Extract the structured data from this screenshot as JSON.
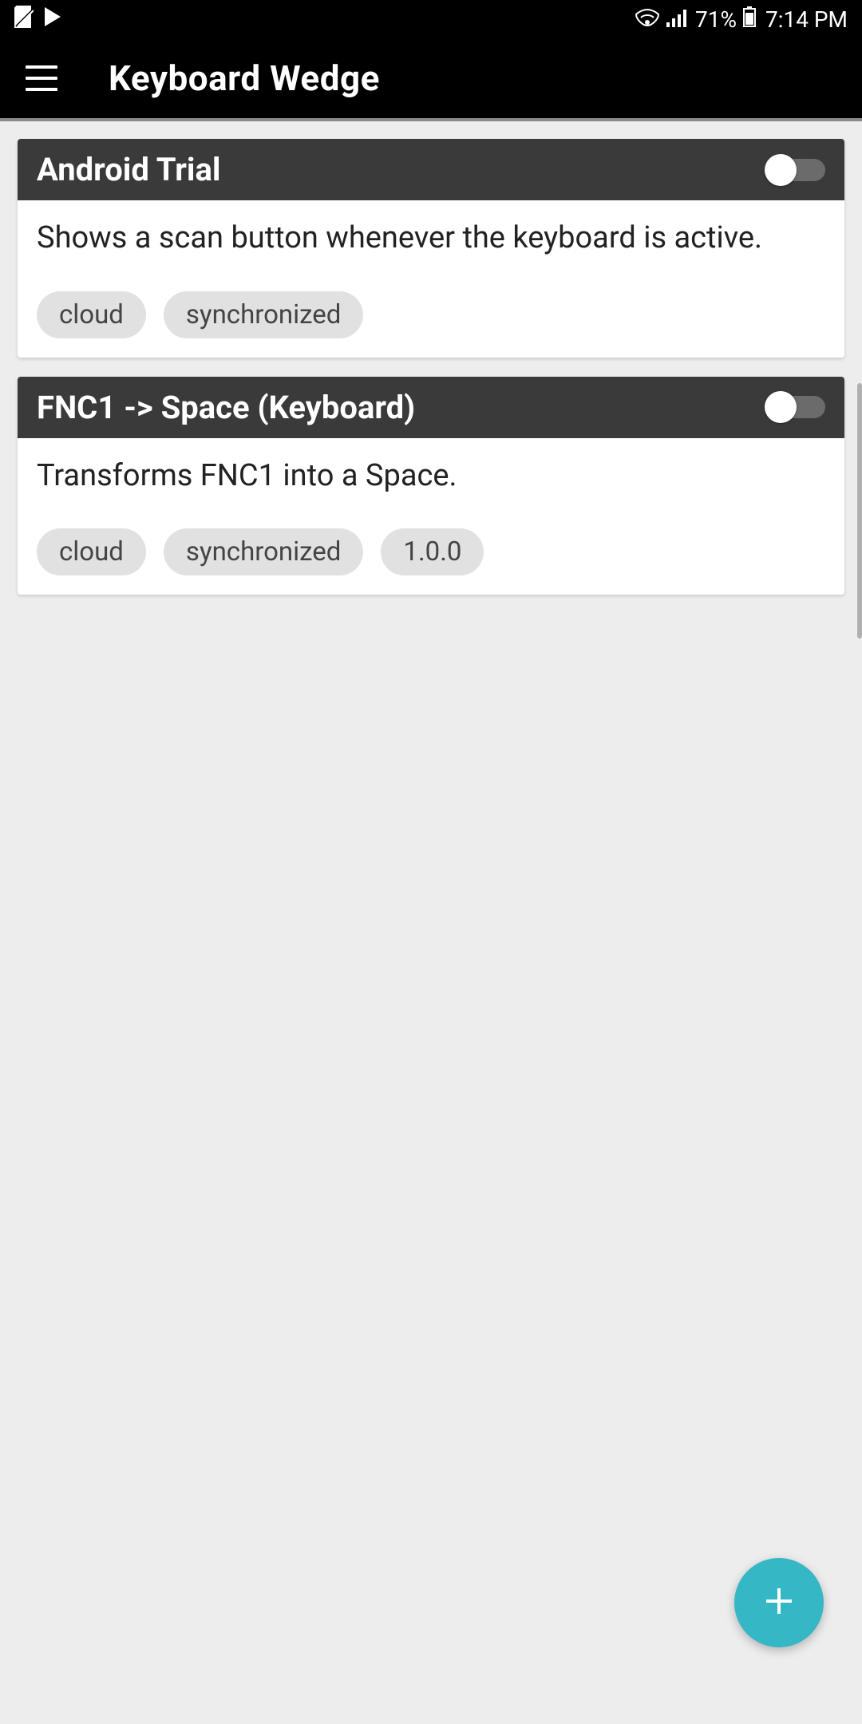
{
  "status": {
    "battery_percent": "71%",
    "time": "7:14 PM"
  },
  "appbar": {
    "title": "Keyboard Wedge"
  },
  "cards": [
    {
      "title": "Android Trial",
      "description": "Shows a scan button whenever the keyboard is active.",
      "chips": [
        "cloud",
        "synchronized"
      ]
    },
    {
      "title": "FNC1 -> Space (Keyboard)",
      "description": "Transforms FNC1 into a Space.",
      "chips": [
        "cloud",
        "synchronized",
        "1.0.0"
      ]
    }
  ]
}
